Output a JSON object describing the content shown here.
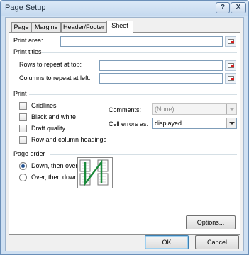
{
  "window": {
    "title": "Page Setup",
    "help_btn": "?",
    "close_btn": "X"
  },
  "tabs": [
    {
      "label": "Page"
    },
    {
      "label": "Margins"
    },
    {
      "label": "Header/Footer"
    },
    {
      "label": "Sheet"
    }
  ],
  "sheet": {
    "print_area_label": "Print area:",
    "print_titles_label": "Print titles",
    "rows_repeat_label": "Rows to repeat at top:",
    "cols_repeat_label": "Columns to repeat at left:",
    "print_section": "Print",
    "gridlines": "Gridlines",
    "black_white": "Black and white",
    "draft_quality": "Draft quality",
    "row_col_headings": "Row and column headings",
    "comments_label": "Comments:",
    "comments_value": "(None)",
    "cell_errors_label": "Cell errors as:",
    "cell_errors_value": "displayed",
    "page_order_section": "Page order",
    "down_then_over": "Down, then over",
    "over_then_down": "Over, then down",
    "options_btn": "Options..."
  },
  "footer": {
    "ok": "OK",
    "cancel": "Cancel"
  },
  "colors": {
    "accent": "#1f4f8f",
    "arrow": "#1a8a3a"
  }
}
